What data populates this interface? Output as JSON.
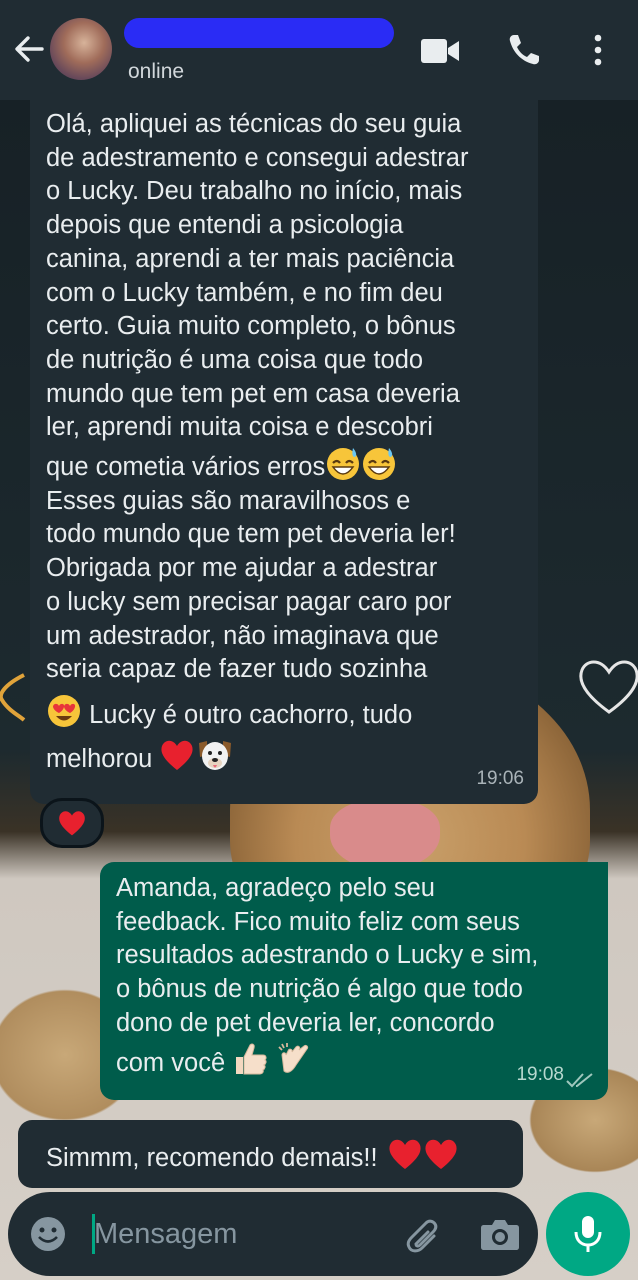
{
  "header": {
    "status": "online",
    "icons": [
      "back-arrow-icon",
      "video-call-icon",
      "phone-icon",
      "more-options-icon"
    ]
  },
  "messages": [
    {
      "direction": "incoming",
      "text_part1": "Olá, apliquei as técnicas do seu guia\nde adestramento e consegui adestrar\no Lucky. Deu trabalho no início, mais\ndepois que entendi a psicologia\ncanina, aprendi a ter mais paciência\ncom o Lucky também, e no fim deu\ncerto. Guia muito completo, o bônus\nde nutrição é uma coisa que todo\nmundo que tem pet em casa deveria\nler, aprendi muita coisa e descobri\nque cometia vários erros",
      "text_part2": "Esses guias são maravilhosos e\ntodo mundo que tem pet deveria ler!\nObrigada por me ajudar a adestrar\no lucky sem precisar pagar caro por\num adestrador, não imaginava que\nseria capaz de fazer tudo sozinha",
      "text_part3": " Lucky é outro cachorro, tudo",
      "text_part4": "melhorou ",
      "time": "19:06",
      "reaction": "heart"
    },
    {
      "direction": "outgoing",
      "text_part1": "Amanda, agradeço pelo seu\nfeedback. Fico muito feliz com seus\nresultados adestrando o Lucky e sim,\no bônus de nutrição é algo que todo\ndono de pet deveria ler, concordo",
      "text_part2": "com você ",
      "time": "19:08",
      "status": "read"
    },
    {
      "direction": "incoming",
      "text": "Simmm, recomendo demais!! "
    }
  ],
  "input": {
    "placeholder": "Mensagem"
  },
  "colors": {
    "header_bg": "#202c33",
    "incoming_bg": "#202c33",
    "outgoing_bg": "#005c4b",
    "accent": "#00a884",
    "redaction": "#2a2cf5"
  }
}
